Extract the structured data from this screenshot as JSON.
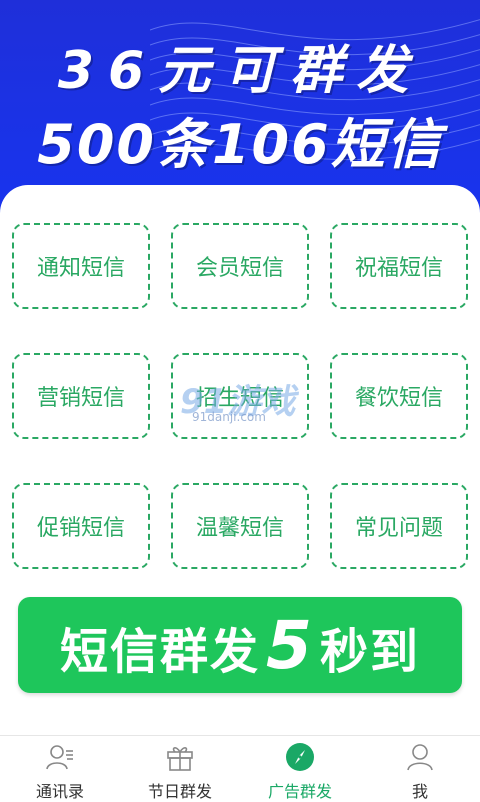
{
  "header": {
    "line1": "36元可群发",
    "line2": "500条106短信"
  },
  "tiles": [
    {
      "label": "通知短信"
    },
    {
      "label": "会员短信"
    },
    {
      "label": "祝福短信"
    },
    {
      "label": "营销短信"
    },
    {
      "label": "招生短信"
    },
    {
      "label": "餐饮短信"
    },
    {
      "label": "促销短信"
    },
    {
      "label": "温馨短信"
    },
    {
      "label": "常见问题"
    }
  ],
  "cta": {
    "prefix": "短信群发",
    "number": "5",
    "suffix": "秒到"
  },
  "watermark": {
    "main": "91游戏",
    "sub": "91danji.com"
  },
  "tabs": [
    {
      "label": "通讯录",
      "icon": "contacts-icon"
    },
    {
      "label": "节日群发",
      "icon": "gift-icon"
    },
    {
      "label": "广告群发",
      "icon": "compass-icon",
      "active": true
    },
    {
      "label": "我",
      "icon": "user-icon"
    }
  ],
  "colors": {
    "header_blue": "#1a33e8",
    "tile_green": "#2aa863",
    "cta_green": "#1ec65b",
    "active_tab": "#1aa866"
  }
}
